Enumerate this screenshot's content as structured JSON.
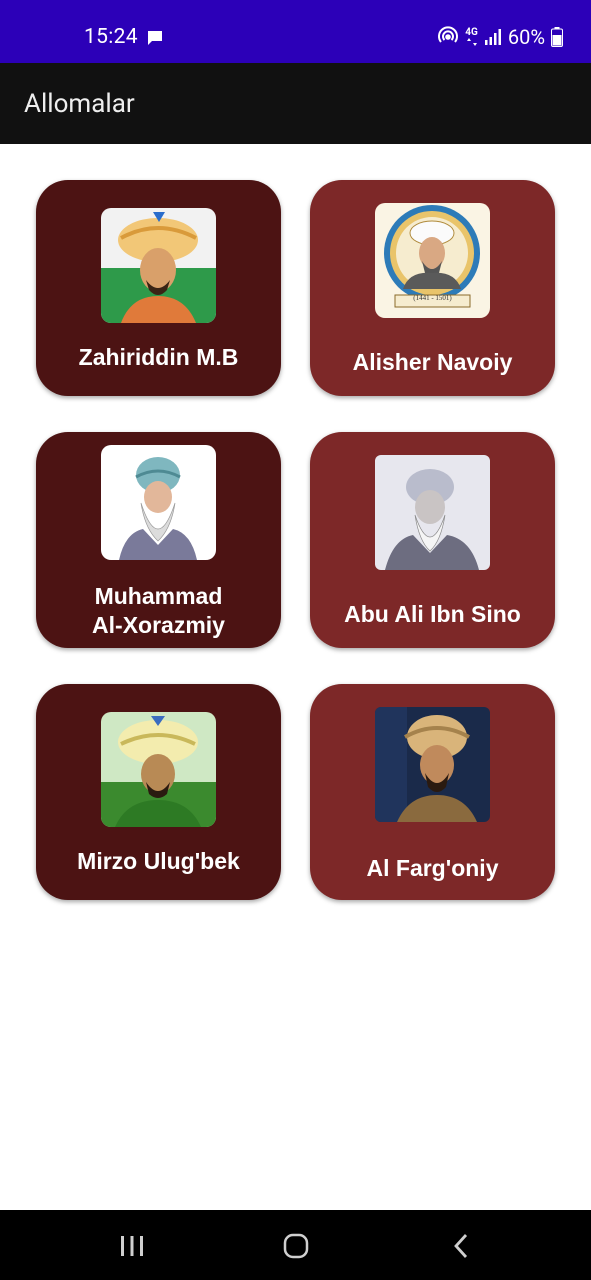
{
  "status_bar": {
    "time": "15:24",
    "network": "4G",
    "battery": "60%",
    "icons": [
      "message-icon",
      "hotspot-icon",
      "data-arrows-icon",
      "signal-icon",
      "battery-icon"
    ]
  },
  "app_bar": {
    "title": "Allomalar"
  },
  "cards": [
    {
      "label": "Zahiriddin M.B",
      "portrait": "babur-portrait"
    },
    {
      "label": "Alisher Navoiy",
      "portrait": "navoiy-portrait",
      "caption": "(1441 - 1501)"
    },
    {
      "label_line1": "Muhammad",
      "label_line2": "Al-Xorazmiy",
      "portrait": "xorazmiy-portrait"
    },
    {
      "label": "Abu Ali Ibn Sino",
      "portrait": "ibn-sino-portrait"
    },
    {
      "label": "Mirzo Ulug'bek",
      "portrait": "ulugbek-portrait"
    },
    {
      "label": "Al Farg'oniy",
      "portrait": "farg-oniy-portrait"
    }
  ],
  "colors": {
    "status_bar": "#2c00b8",
    "app_bar": "#111111",
    "card_dark": "#4c1313",
    "card_light": "#7d2828",
    "nav_bar": "#000000"
  },
  "nav_bar": {
    "icons": [
      "recent-apps-icon",
      "home-icon",
      "back-icon"
    ]
  }
}
